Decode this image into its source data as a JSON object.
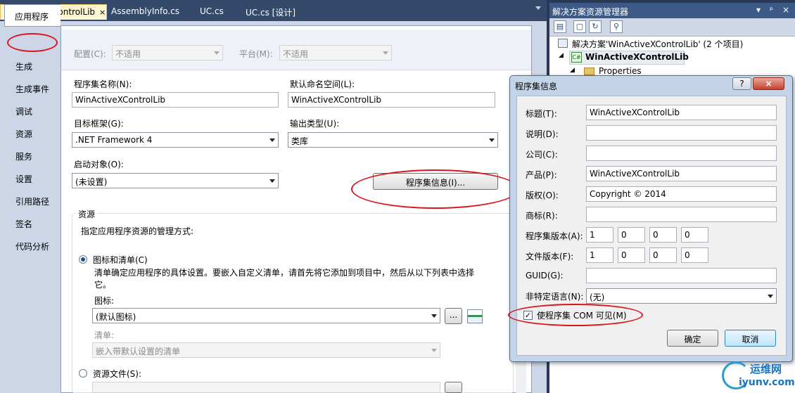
{
  "doc_tabs": {
    "items": [
      "WinActiveXControlLib",
      "AssemblyInfo.cs",
      "UC.cs",
      "UC.cs [设计]"
    ],
    "close_glyph": "×"
  },
  "prop_tabs": [
    "应用程序",
    "生成",
    "生成事件",
    "调试",
    "资源",
    "服务",
    "设置",
    "引用路径",
    "签名",
    "代码分析"
  ],
  "config": {
    "config_label": "配置(C):",
    "config_value": "不适用",
    "platform_label": "平台(M):",
    "platform_value": "不适用"
  },
  "app": {
    "asm_name_label": "程序集名称(N):",
    "asm_name_value": "WinActiveXControlLib",
    "ns_label": "默认命名空间(L):",
    "ns_value": "WinActiveXControlLib",
    "fw_label": "目标框架(G):",
    "fw_value": ".NET Framework 4",
    "out_label": "输出类型(U):",
    "out_value": "类库",
    "startup_label": "启动对象(O):",
    "startup_value": "(未设置)",
    "asm_info_button": "程序集信息(I)..."
  },
  "resources": {
    "group_label": "资源",
    "desc": "指定应用程序资源的管理方式:",
    "opt1_label": "图标和清单(C)",
    "opt1_desc": "清单确定应用程序的具体设置。要嵌入自定义清单，请首先将它添加到项目中，然后从以下列表中选择它。",
    "icon_label": "图标:",
    "icon_value": "(默认图标)",
    "browse_label": "...",
    "manifest_label": "清单:",
    "manifest_value": "嵌入带默认设置的清单",
    "opt2_label": "资源文件(S):"
  },
  "solution_explorer": {
    "title": "解决方案资源管理器",
    "title_buttons": [
      "▾",
      "ᵖ",
      "×"
    ],
    "solution_label": "解决方案'WinActiveXControlLib' (2 个项目)",
    "project_label": "WinActiveXControlLib",
    "properties_label": "Properties"
  },
  "dialog": {
    "title": "程序集信息",
    "help_label": "?",
    "close_label": "×",
    "fields": [
      {
        "label": "标题(T):",
        "value": "WinActiveXControlLib"
      },
      {
        "label": "说明(D):",
        "value": ""
      },
      {
        "label": "公司(C):",
        "value": ""
      },
      {
        "label": "产品(P):",
        "value": "WinActiveXControlLib"
      },
      {
        "label": "版权(O):",
        "value": "Copyright ©  2014"
      },
      {
        "label": "商标(R):",
        "value": ""
      }
    ],
    "asm_version_label": "程序集版本(A):",
    "asm_version": [
      "1",
      "0",
      "0",
      "0"
    ],
    "file_version_label": "文件版本(F):",
    "file_version": [
      "1",
      "0",
      "0",
      "0"
    ],
    "guid_label": "GUID(G):",
    "guid_value": "",
    "lang_label": "非特定语言(N):",
    "lang_value": "(无)",
    "com_visible_label": "使程序集 COM 可见(M)",
    "com_visible_checked": true,
    "ok_label": "确定",
    "cancel_label": "取消"
  },
  "watermark": {
    "cn": "运维网",
    "url": "iyunv.com"
  },
  "colors": {
    "highlight_circle": "#d9161d",
    "active_tab": "#fdf6d0",
    "title_bar": "#3d5a86"
  }
}
